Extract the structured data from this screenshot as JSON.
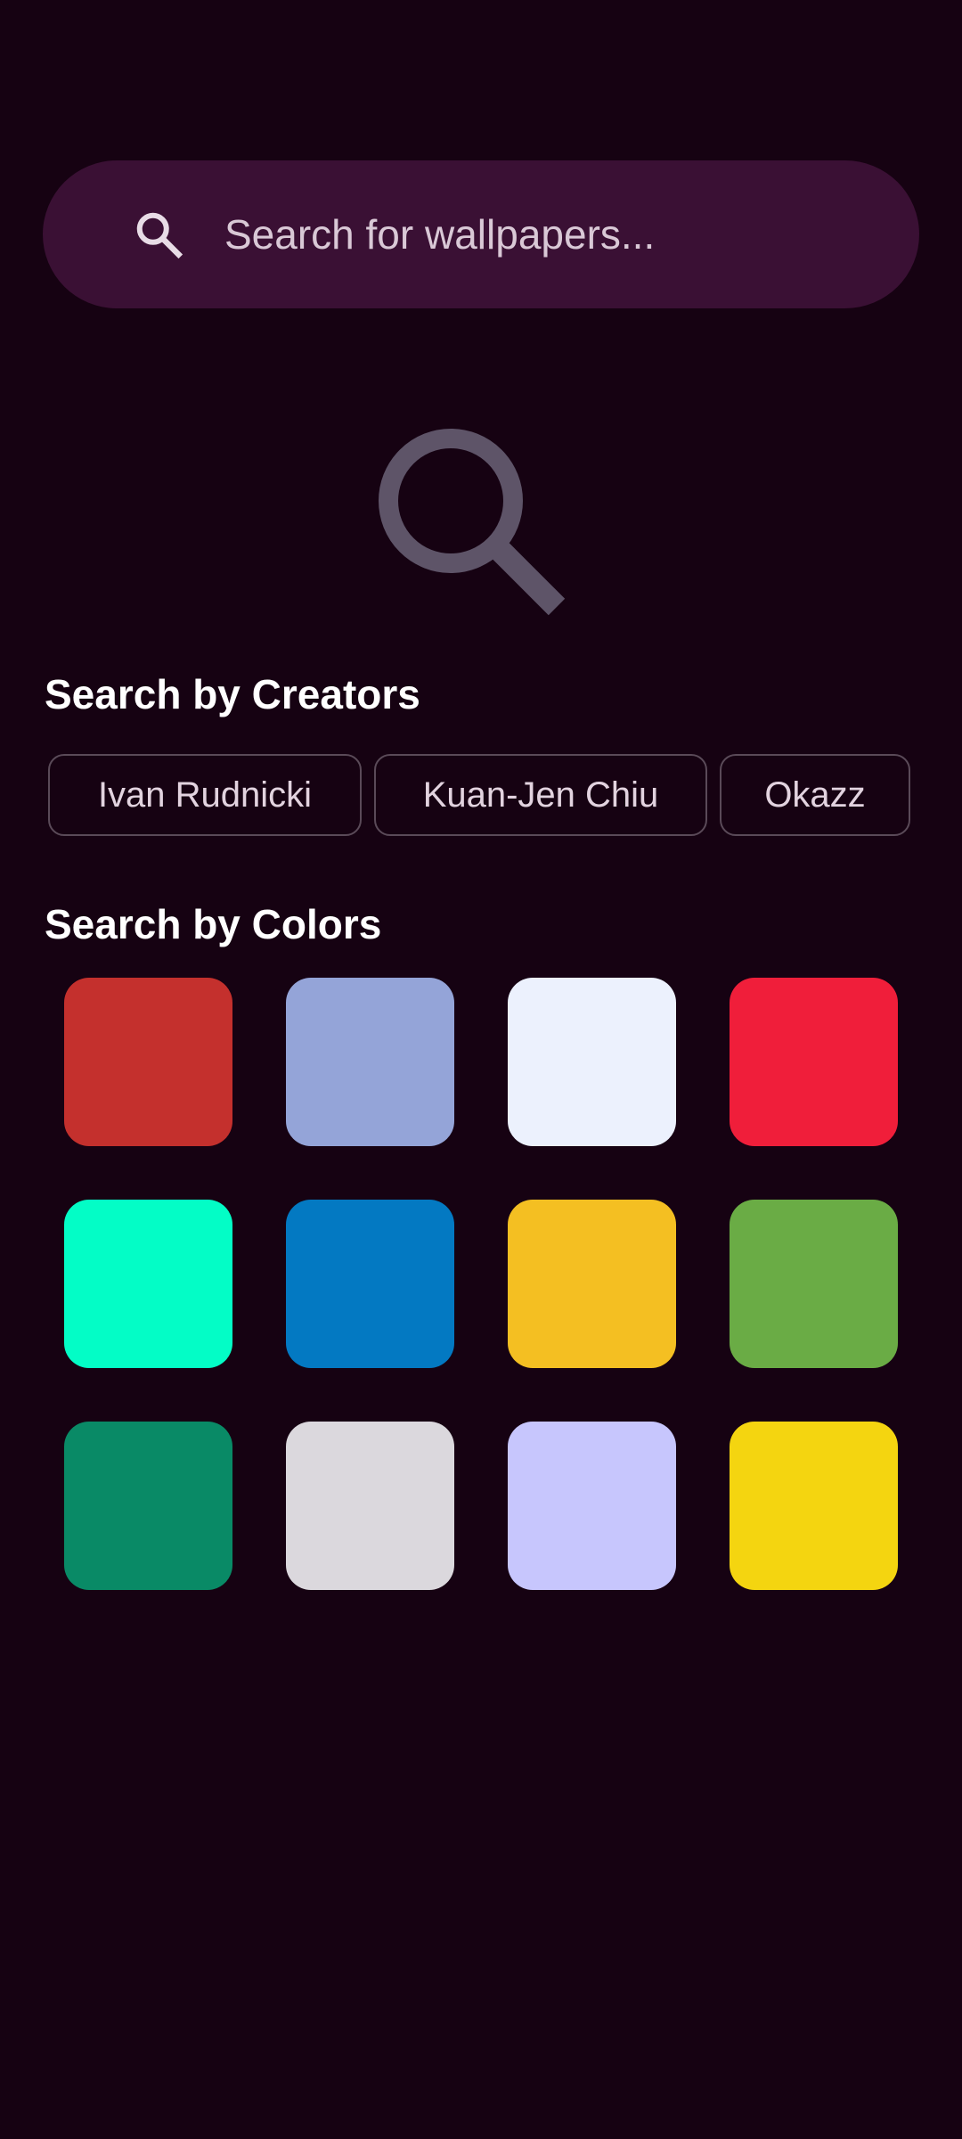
{
  "search": {
    "placeholder": "Search for wallpapers...",
    "icon": "search-icon"
  },
  "hero": {
    "icon": "search-icon",
    "color": "#5e5468"
  },
  "creators": {
    "title": "Search by Creators",
    "items": [
      "Ivan Rudnicki",
      "Kuan-Jen Chiu",
      "Okazz",
      ""
    ]
  },
  "colors": {
    "title": "Search by Colors",
    "swatches": [
      "#c4302d",
      "#94a4d8",
      "#ecf1fd",
      "#f01e3a",
      "#03fdc6",
      "#0379c2",
      "#f4bf22",
      "#6aac45",
      "#098a66",
      "#dbd8dd",
      "#c7c6fd",
      "#f4d510"
    ]
  },
  "theme": {
    "background": "#160212",
    "search_bar": "#3a1034",
    "chip_border": "#5a4a58"
  }
}
